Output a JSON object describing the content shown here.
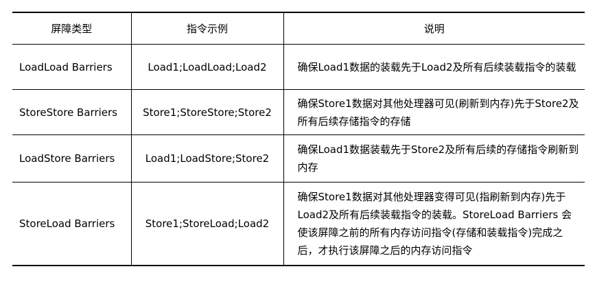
{
  "table": {
    "headers": [
      "屏障类型",
      "指令示例",
      "说明"
    ],
    "rows": [
      {
        "type": "LoadLoad Barriers",
        "example": "Load1;LoadLoad;Load2",
        "description": "确保Load1数据的装载先于Load2及所有后续装载指令的装载"
      },
      {
        "type": "StoreStore Barriers",
        "example": "Store1;StoreStore;Store2",
        "description": "确保Store1数据对其他处理器可见(刷新到内存)先于Store2及所有后续存储指令的存储"
      },
      {
        "type": "LoadStore Barriers",
        "example": "Load1;LoadStore;Store2",
        "description": "确保Load1数据装载先于Store2及所有后续的存储指令刷新到内存"
      },
      {
        "type": "StoreLoad Barriers",
        "example": "Store1;StoreLoad;Load2",
        "description": "确保Store1数据对其他处理器变得可见(指刷新到内存)先于Load2及所有后续装载指令的装载。StoreLoad Barriers 会使该屏障之前的所有内存访问指令(存储和装载指令)完成之后，才执行该屏障之后的内存访问指令"
      }
    ]
  }
}
